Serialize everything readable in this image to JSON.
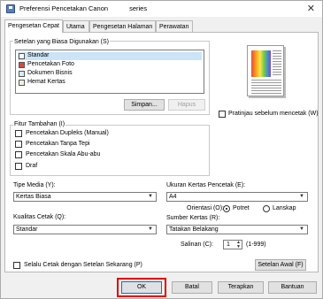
{
  "window": {
    "title": "Preferensi Pencetakan Canon",
    "title_suffix": "series",
    "close_glyph": "✕"
  },
  "tabs": [
    {
      "label": "Pengesetan Cepat",
      "active": true
    },
    {
      "label": "Utama",
      "active": false
    },
    {
      "label": "Pengesetan Halaman",
      "active": false
    },
    {
      "label": "Perawatan",
      "active": false
    }
  ],
  "common_settings": {
    "label": "Setelan yang Biasa Digunakan (S)",
    "items": [
      {
        "label": "Standar",
        "icon": "standard-document-icon",
        "selected": true
      },
      {
        "label": "Pencetakan Foto",
        "icon": "photo-print-icon",
        "selected": false
      },
      {
        "label": "Dokumen Bisnis",
        "icon": "business-document-icon",
        "selected": false
      },
      {
        "label": "Hemat Kertas",
        "icon": "paper-saving-icon",
        "selected": false
      }
    ],
    "save_button": "Simpan...",
    "delete_button": "Hapus"
  },
  "preview": {
    "checkbox_label": "Pratinjau sebelum mencetak (W)",
    "checked": false
  },
  "additional_features": {
    "label": "Fitur Tambahan (I)",
    "items": [
      {
        "label": "Pencetakan Dupleks (Manual)",
        "checked": false
      },
      {
        "label": "Pencetakan Tanpa Tepi",
        "checked": false
      },
      {
        "label": "Pencetakan Skala Abu-abu",
        "checked": false
      },
      {
        "label": "Draf",
        "checked": false
      }
    ]
  },
  "media_type": {
    "label": "Tipe Media (Y):",
    "value": "Kertas Biasa"
  },
  "print_quality": {
    "label": "Kualitas Cetak (Q):",
    "value": "Standar"
  },
  "paper_size": {
    "label": "Ukuran Kertas Pencetak (E):",
    "value": "A4"
  },
  "orientation": {
    "label": "Orientasi (O):",
    "portrait": "Potret",
    "landscape": "Lanskap",
    "selected": "Potret"
  },
  "paper_source": {
    "label": "Sumber Kertas (R):",
    "value": "Tatakan Belakang"
  },
  "copies": {
    "label": "Salinan (C):",
    "value": "1",
    "range": "(1-999)"
  },
  "always_print": {
    "label": "Selalu Cetak dengan Setelan Sekarang (P)",
    "checked": false
  },
  "defaults_button": "Setelan Awal (F)",
  "footer": {
    "ok": "OK",
    "cancel": "Batal",
    "apply": "Terapkan",
    "help": "Bantuan"
  },
  "colors": {
    "highlight": "#e00000",
    "selection": "#cce4f7"
  }
}
